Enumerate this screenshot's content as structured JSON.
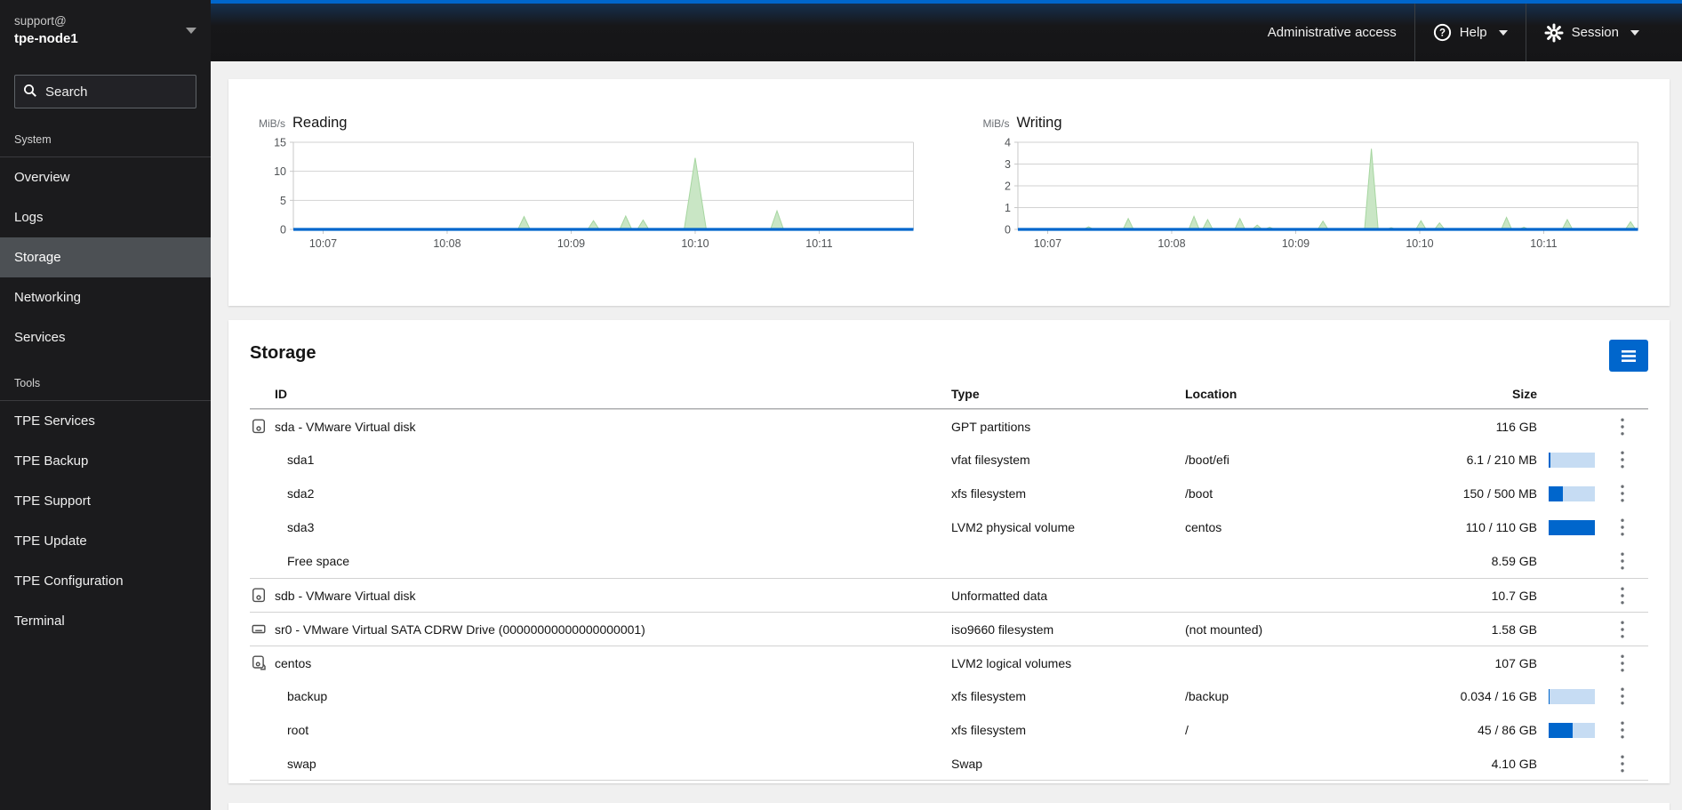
{
  "colors": {
    "accent": "#0066cc",
    "nav_selected": "#4c5054",
    "chart_area_fill": "#c9e6c5",
    "chart_area_line": "#a6d6a0",
    "chart_baseline": "#0066cc",
    "usage_bar_bg": "#c6dcf3",
    "usage_bar_fill": "#0066cc"
  },
  "masthead": {
    "admin_access": "Administrative access",
    "help": "Help",
    "session": "Session"
  },
  "sidebar": {
    "user": "support@",
    "host": "tpe-node1",
    "search_placeholder": "Search",
    "sections": [
      {
        "label": "System",
        "items": [
          {
            "label": "Overview",
            "selected": false
          },
          {
            "label": "Logs",
            "selected": false
          },
          {
            "label": "Storage",
            "selected": true
          },
          {
            "label": "Networking",
            "selected": false
          },
          {
            "label": "Services",
            "selected": false
          }
        ]
      },
      {
        "label": "Tools",
        "items": [
          {
            "label": "TPE Services",
            "selected": false
          },
          {
            "label": "TPE Backup",
            "selected": false
          },
          {
            "label": "TPE Support",
            "selected": false
          },
          {
            "label": "TPE Update",
            "selected": false
          },
          {
            "label": "TPE Configuration",
            "selected": false
          },
          {
            "label": "Terminal",
            "selected": false
          }
        ]
      }
    ]
  },
  "chart_data": [
    {
      "type": "area",
      "title": "Reading",
      "unit": "MiB/s",
      "ylabel": "MiB/s",
      "ylim": [
        0,
        15
      ],
      "yticks": [
        0,
        5,
        10,
        15
      ],
      "x_start": 6.76,
      "x_end": 11.76,
      "xticks": [
        {
          "v": 7,
          "label": "10:07"
        },
        {
          "v": 8,
          "label": "10:08"
        },
        {
          "v": 9,
          "label": "10:09"
        },
        {
          "v": 10,
          "label": "10:10"
        },
        {
          "v": 11,
          "label": "10:11"
        }
      ],
      "grid": true,
      "spikes_minutes_vs_mibs": [
        [
          8.62,
          2.2
        ],
        [
          9.18,
          1.5
        ],
        [
          9.44,
          2.3
        ],
        [
          9.58,
          1.6
        ],
        [
          10.0,
          12.3
        ],
        [
          10.66,
          3.2
        ]
      ]
    },
    {
      "type": "area",
      "title": "Writing",
      "unit": "MiB/s",
      "ylabel": "MiB/s",
      "ylim": [
        0,
        4
      ],
      "yticks": [
        0,
        1,
        2,
        3,
        4
      ],
      "x_start": 6.76,
      "x_end": 11.76,
      "xticks": [
        {
          "v": 7,
          "label": "10:07"
        },
        {
          "v": 8,
          "label": "10:08"
        },
        {
          "v": 9,
          "label": "10:09"
        },
        {
          "v": 10,
          "label": "10:10"
        },
        {
          "v": 11,
          "label": "10:11"
        }
      ],
      "grid": true,
      "spikes_minutes_vs_mibs": [
        [
          7.33,
          0.12
        ],
        [
          7.65,
          0.5
        ],
        [
          8.18,
          0.6
        ],
        [
          8.29,
          0.45
        ],
        [
          8.55,
          0.5
        ],
        [
          8.69,
          0.2
        ],
        [
          8.79,
          0.1
        ],
        [
          9.22,
          0.38
        ],
        [
          9.61,
          3.7
        ],
        [
          9.77,
          0.08
        ],
        [
          10.01,
          0.4
        ],
        [
          10.16,
          0.3
        ],
        [
          10.7,
          0.55
        ],
        [
          10.84,
          0.1
        ],
        [
          11.19,
          0.45
        ],
        [
          11.7,
          0.35
        ]
      ]
    }
  ],
  "storage": {
    "title": "Storage",
    "columns": {
      "id": "ID",
      "type": "Type",
      "location": "Location",
      "size": "Size"
    },
    "rows": [
      {
        "icon": "disk",
        "id": "sda - VMware Virtual disk",
        "type": "GPT partitions",
        "location": "",
        "size": "116 GB",
        "usage": null,
        "level": 0
      },
      {
        "icon": null,
        "id": "sda1",
        "type": "vfat filesystem",
        "location": "/boot/efi",
        "size": "6.1 / 210 MB",
        "usage": 0.03,
        "level": 1
      },
      {
        "icon": null,
        "id": "sda2",
        "type": "xfs filesystem",
        "location": "/boot",
        "size": "150 / 500 MB",
        "usage": 0.3,
        "level": 1
      },
      {
        "icon": null,
        "id": "sda3",
        "type": "LVM2 physical volume",
        "location": "centos",
        "size": "110 / 110 GB",
        "usage": 1.0,
        "level": 1
      },
      {
        "icon": null,
        "id": "Free space",
        "type": "",
        "location": "",
        "size": "8.59 GB",
        "usage": null,
        "level": 1
      },
      {
        "icon": "disk",
        "id": "sdb - VMware Virtual disk",
        "type": "Unformatted data",
        "location": "",
        "size": "10.7 GB",
        "usage": null,
        "level": 0
      },
      {
        "icon": "cdrom",
        "id": "sr0 - VMware Virtual SATA CDRW Drive (00000000000000000001)",
        "type": "iso9660 filesystem",
        "location": "(not mounted)",
        "size": "1.58 GB",
        "usage": null,
        "level": 0
      },
      {
        "icon": "volume-group",
        "id": "centos",
        "type": "LVM2 logical volumes",
        "location": "",
        "size": "107 GB",
        "usage": null,
        "level": 0
      },
      {
        "icon": null,
        "id": "backup",
        "type": "xfs filesystem",
        "location": "/backup",
        "size": "0.034 / 16 GB",
        "usage": 0.004,
        "level": 1
      },
      {
        "icon": null,
        "id": "root",
        "type": "xfs filesystem",
        "location": "/",
        "size": "45 / 86 GB",
        "usage": 0.52,
        "level": 1
      },
      {
        "icon": null,
        "id": "swap",
        "type": "Swap",
        "location": "",
        "size": "4.10 GB",
        "usage": null,
        "level": 1
      }
    ]
  }
}
